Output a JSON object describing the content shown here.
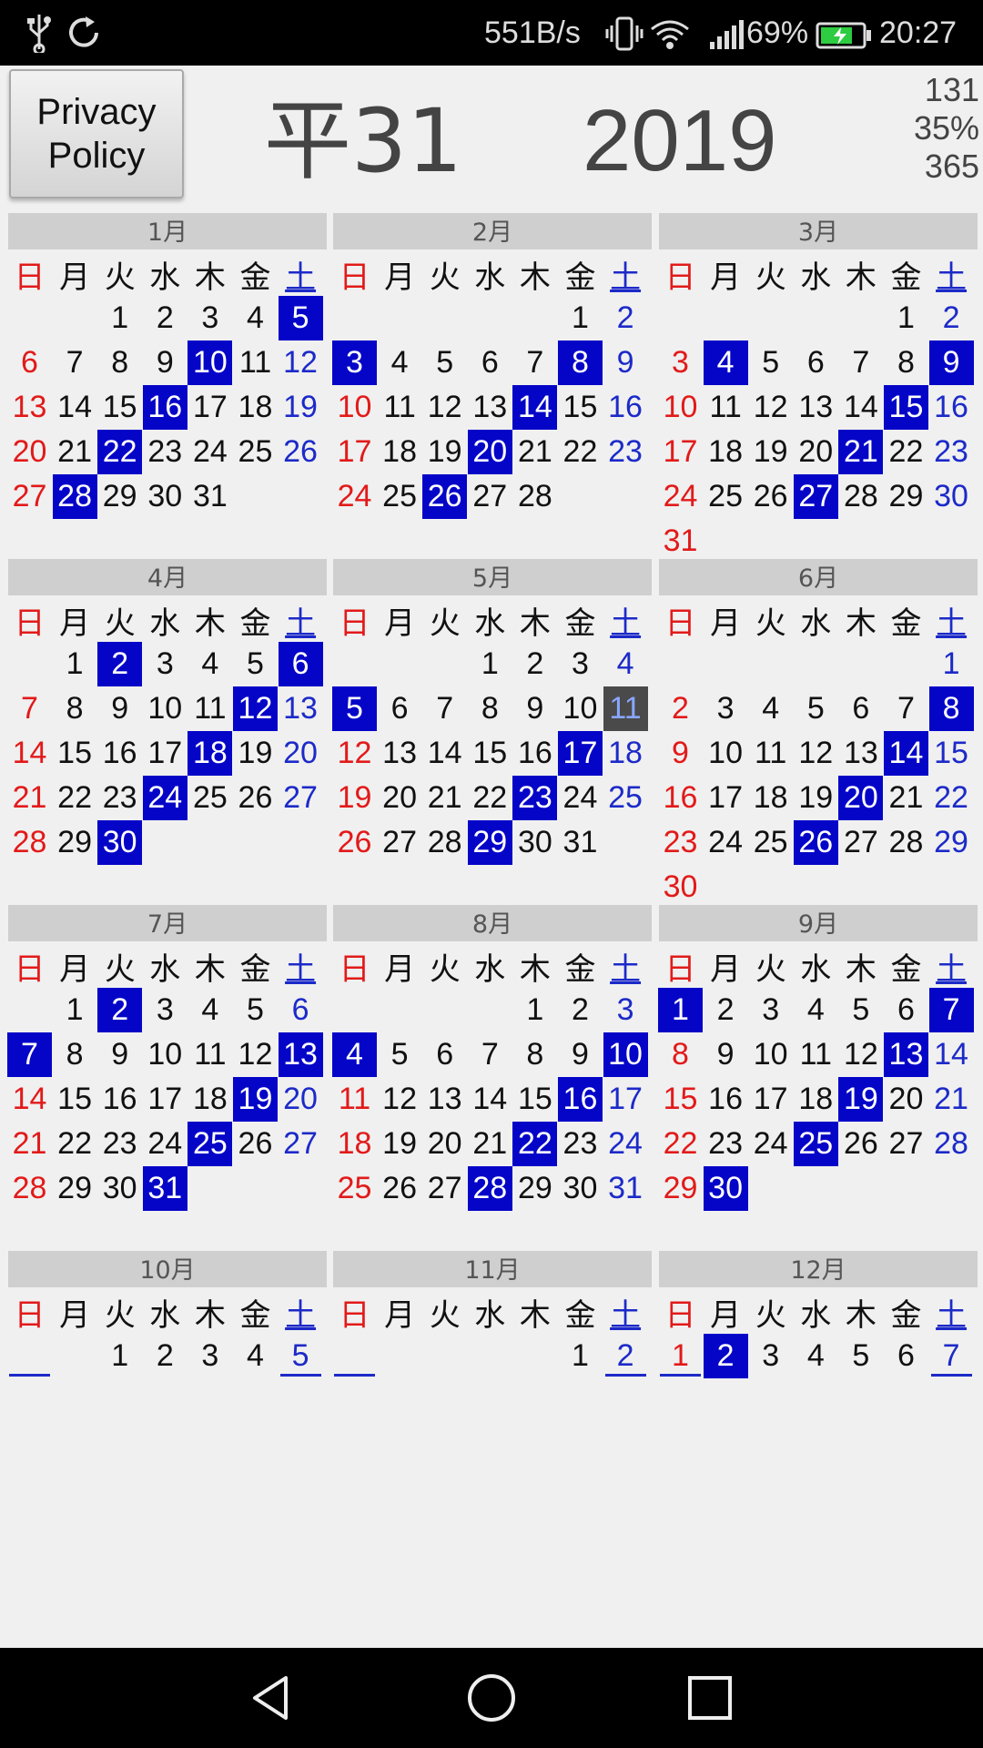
{
  "status_bar": {
    "net_speed": "551B/s",
    "battery": "69%",
    "time": "20:27",
    "icons": [
      "usb-icon",
      "sync-icon",
      "vibrate-icon",
      "wifi-icon",
      "signal-icon",
      "battery-charging-icon"
    ]
  },
  "header": {
    "privacy_button": "Privacy\nPolicy",
    "era_year": "平31",
    "ad_year": "2019",
    "stats": [
      "131",
      "35%",
      "365"
    ]
  },
  "colors": {
    "sunday": "#e21a1a",
    "saturday": "#1c2ac8",
    "highlight": "#0505c8",
    "today": "#4a4a4a"
  },
  "weekdays": [
    "日",
    "月",
    "火",
    "水",
    "木",
    "金",
    "土"
  ],
  "months": [
    {
      "title": "1月",
      "rows": [
        [
          "",
          "",
          "1",
          "2",
          "3",
          "4",
          "5"
        ],
        [
          "6",
          "7",
          "8",
          "9",
          "10",
          "11",
          "12"
        ],
        [
          "13",
          "14",
          "15",
          "16",
          "17",
          "18",
          "19"
        ],
        [
          "20",
          "21",
          "22",
          "23",
          "24",
          "25",
          "26"
        ],
        [
          "27",
          "28",
          "29",
          "30",
          "31",
          "",
          ""
        ]
      ],
      "highlights": [
        "5",
        "10",
        "16",
        "22",
        "28"
      ]
    },
    {
      "title": "2月",
      "rows": [
        [
          "",
          "",
          "",
          "",
          "",
          "1",
          "2"
        ],
        [
          "3",
          "4",
          "5",
          "6",
          "7",
          "8",
          "9"
        ],
        [
          "10",
          "11",
          "12",
          "13",
          "14",
          "15",
          "16"
        ],
        [
          "17",
          "18",
          "19",
          "20",
          "21",
          "22",
          "23"
        ],
        [
          "24",
          "25",
          "26",
          "27",
          "28",
          "",
          ""
        ]
      ],
      "highlights": [
        "3",
        "8",
        "14",
        "20",
        "26"
      ]
    },
    {
      "title": "3月",
      "rows": [
        [
          "",
          "",
          "",
          "",
          "",
          "1",
          "2"
        ],
        [
          "3",
          "4",
          "5",
          "6",
          "7",
          "8",
          "9"
        ],
        [
          "10",
          "11",
          "12",
          "13",
          "14",
          "15",
          "16"
        ],
        [
          "17",
          "18",
          "19",
          "20",
          "21",
          "22",
          "23"
        ],
        [
          "24",
          "25",
          "26",
          "27",
          "28",
          "29",
          "30"
        ],
        [
          "31",
          "",
          "",
          "",
          "",
          "",
          ""
        ]
      ],
      "highlights": [
        "4",
        "9",
        "15",
        "21",
        "27"
      ]
    },
    {
      "title": "4月",
      "rows": [
        [
          "",
          "1",
          "2",
          "3",
          "4",
          "5",
          "6"
        ],
        [
          "7",
          "8",
          "9",
          "10",
          "11",
          "12",
          "13"
        ],
        [
          "14",
          "15",
          "16",
          "17",
          "18",
          "19",
          "20"
        ],
        [
          "21",
          "22",
          "23",
          "24",
          "25",
          "26",
          "27"
        ],
        [
          "28",
          "29",
          "30",
          "",
          "",
          "",
          ""
        ]
      ],
      "highlights": [
        "2",
        "6",
        "12",
        "18",
        "24",
        "30"
      ]
    },
    {
      "title": "5月",
      "rows": [
        [
          "",
          "",
          "",
          "1",
          "2",
          "3",
          "4"
        ],
        [
          "5",
          "6",
          "7",
          "8",
          "9",
          "10",
          "11"
        ],
        [
          "12",
          "13",
          "14",
          "15",
          "16",
          "17",
          "18"
        ],
        [
          "19",
          "20",
          "21",
          "22",
          "23",
          "24",
          "25"
        ],
        [
          "26",
          "27",
          "28",
          "29",
          "30",
          "31",
          ""
        ]
      ],
      "highlights": [
        "5",
        "17",
        "23",
        "29"
      ],
      "today": "11"
    },
    {
      "title": "6月",
      "rows": [
        [
          "",
          "",
          "",
          "",
          "",
          "",
          "1"
        ],
        [
          "2",
          "3",
          "4",
          "5",
          "6",
          "7",
          "8"
        ],
        [
          "9",
          "10",
          "11",
          "12",
          "13",
          "14",
          "15"
        ],
        [
          "16",
          "17",
          "18",
          "19",
          "20",
          "21",
          "22"
        ],
        [
          "23",
          "24",
          "25",
          "26",
          "27",
          "28",
          "29"
        ],
        [
          "30",
          "",
          "",
          "",
          "",
          "",
          ""
        ]
      ],
      "highlights": [
        "8",
        "14",
        "20",
        "26"
      ]
    },
    {
      "title": "7月",
      "rows": [
        [
          "",
          "1",
          "2",
          "3",
          "4",
          "5",
          "6"
        ],
        [
          "7",
          "8",
          "9",
          "10",
          "11",
          "12",
          "13"
        ],
        [
          "14",
          "15",
          "16",
          "17",
          "18",
          "19",
          "20"
        ],
        [
          "21",
          "22",
          "23",
          "24",
          "25",
          "26",
          "27"
        ],
        [
          "28",
          "29",
          "30",
          "31",
          "",
          "",
          ""
        ]
      ],
      "highlights": [
        "2",
        "7",
        "13",
        "19",
        "25",
        "31"
      ]
    },
    {
      "title": "8月",
      "rows": [
        [
          "",
          "",
          "",
          "",
          "1",
          "2",
          "3"
        ],
        [
          "4",
          "5",
          "6",
          "7",
          "8",
          "9",
          "10"
        ],
        [
          "11",
          "12",
          "13",
          "14",
          "15",
          "16",
          "17"
        ],
        [
          "18",
          "19",
          "20",
          "21",
          "22",
          "23",
          "24"
        ],
        [
          "25",
          "26",
          "27",
          "28",
          "29",
          "30",
          "31"
        ]
      ],
      "highlights": [
        "4",
        "10",
        "16",
        "22",
        "28"
      ]
    },
    {
      "title": "9月",
      "rows": [
        [
          "1",
          "2",
          "3",
          "4",
          "5",
          "6",
          "7"
        ],
        [
          "8",
          "9",
          "10",
          "11",
          "12",
          "13",
          "14"
        ],
        [
          "15",
          "16",
          "17",
          "18",
          "19",
          "20",
          "21"
        ],
        [
          "22",
          "23",
          "24",
          "25",
          "26",
          "27",
          "28"
        ],
        [
          "29",
          "30",
          "",
          "",
          "",
          "",
          ""
        ]
      ],
      "highlights": [
        "1",
        "7",
        "13",
        "19",
        "25",
        "30"
      ]
    },
    {
      "title": "10月",
      "rows": [
        [
          "",
          "",
          "1",
          "2",
          "3",
          "4",
          "5"
        ]
      ],
      "highlights": [],
      "underlined": [
        0,
        6
      ]
    },
    {
      "title": "11月",
      "rows": [
        [
          "",
          "",
          "",
          "",
          "",
          "1",
          "2"
        ]
      ],
      "highlights": [],
      "underlined": [
        0,
        6
      ]
    },
    {
      "title": "12月",
      "rows": [
        [
          "1",
          "2",
          "3",
          "4",
          "5",
          "6",
          "7"
        ]
      ],
      "highlights": [
        "2"
      ],
      "underlined": [
        0,
        6
      ]
    }
  ],
  "nav_bar": {
    "icons": [
      "back-icon",
      "home-icon",
      "recents-icon"
    ]
  }
}
